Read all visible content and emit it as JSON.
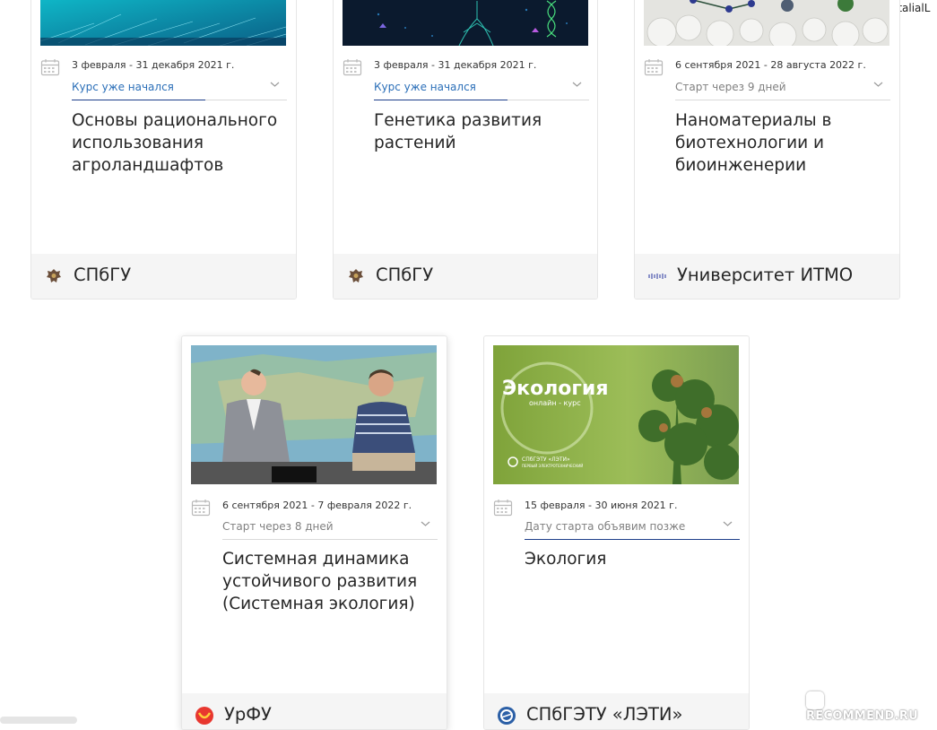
{
  "user": {
    "name": "NatalialL"
  },
  "watermark": {
    "text": "RECOMMEND.RU"
  },
  "colors": {
    "started_link": "#2b6fb8",
    "underline": "#1d3e8a",
    "footer_bg": "#f5f5f5",
    "border": "#e6e6e6"
  },
  "courses": [
    {
      "image": "blue-particles-graphic",
      "date": "3 февраля - 31 декабря 2021 г.",
      "status": "Курс уже начался",
      "status_kind": "started",
      "title_lines": [
        "Основы рационального",
        "использования",
        "агроландшафтов"
      ],
      "university": "СПбГУ",
      "university_logo": "spbgu-eagle-crest"
    },
    {
      "image": "dark-dna-graphic",
      "date": "3 февраля - 31 декабря 2021 г.",
      "status": "Курс уже начался",
      "status_kind": "started",
      "title_lines": [
        "Генетика развития",
        "растений"
      ],
      "university": "СПбГУ",
      "university_logo": "spbgu-eagle-crest"
    },
    {
      "image": "molecules-on-clouds-graphic",
      "date": "6 сентября 2021 - 28 августа 2022 г.",
      "status": "Старт через 9 дней",
      "status_kind": "upcoming",
      "title_lines": [
        "Наноматериалы в",
        "биотехнологии и",
        "биоинженерии"
      ],
      "university": "Университет ИТМО",
      "university_logo": "itmo-logo"
    },
    {
      "image": "two-men-at-map-photo",
      "date": "6 сентября 2021 - 7 февраля 2022 г.",
      "status": "Старт через 8 дней",
      "status_kind": "upcoming",
      "title_lines": [
        "Системная динамика",
        "устойчивого развития",
        "(Системная экология)"
      ],
      "university": "УрФУ",
      "university_logo": "urfu-logo"
    },
    {
      "image": "ecology-banner",
      "image_text": {
        "headline": "Экология",
        "sub": "онлайн - курс",
        "brand": "СПбГЭТУ «ЛЭТИ»",
        "brand_sub": "ПЕРВЫЙ ЭЛЕКТРОТЕХНИЧЕСКИЙ"
      },
      "date": "15 февраля - 30 июня 2021 г.",
      "status": "Дату старта объявим позже",
      "status_kind": "tba",
      "title_lines": [
        "Экология"
      ],
      "university": "СПбГЭТУ «ЛЭТИ»",
      "university_logo": "leti-logo"
    }
  ]
}
